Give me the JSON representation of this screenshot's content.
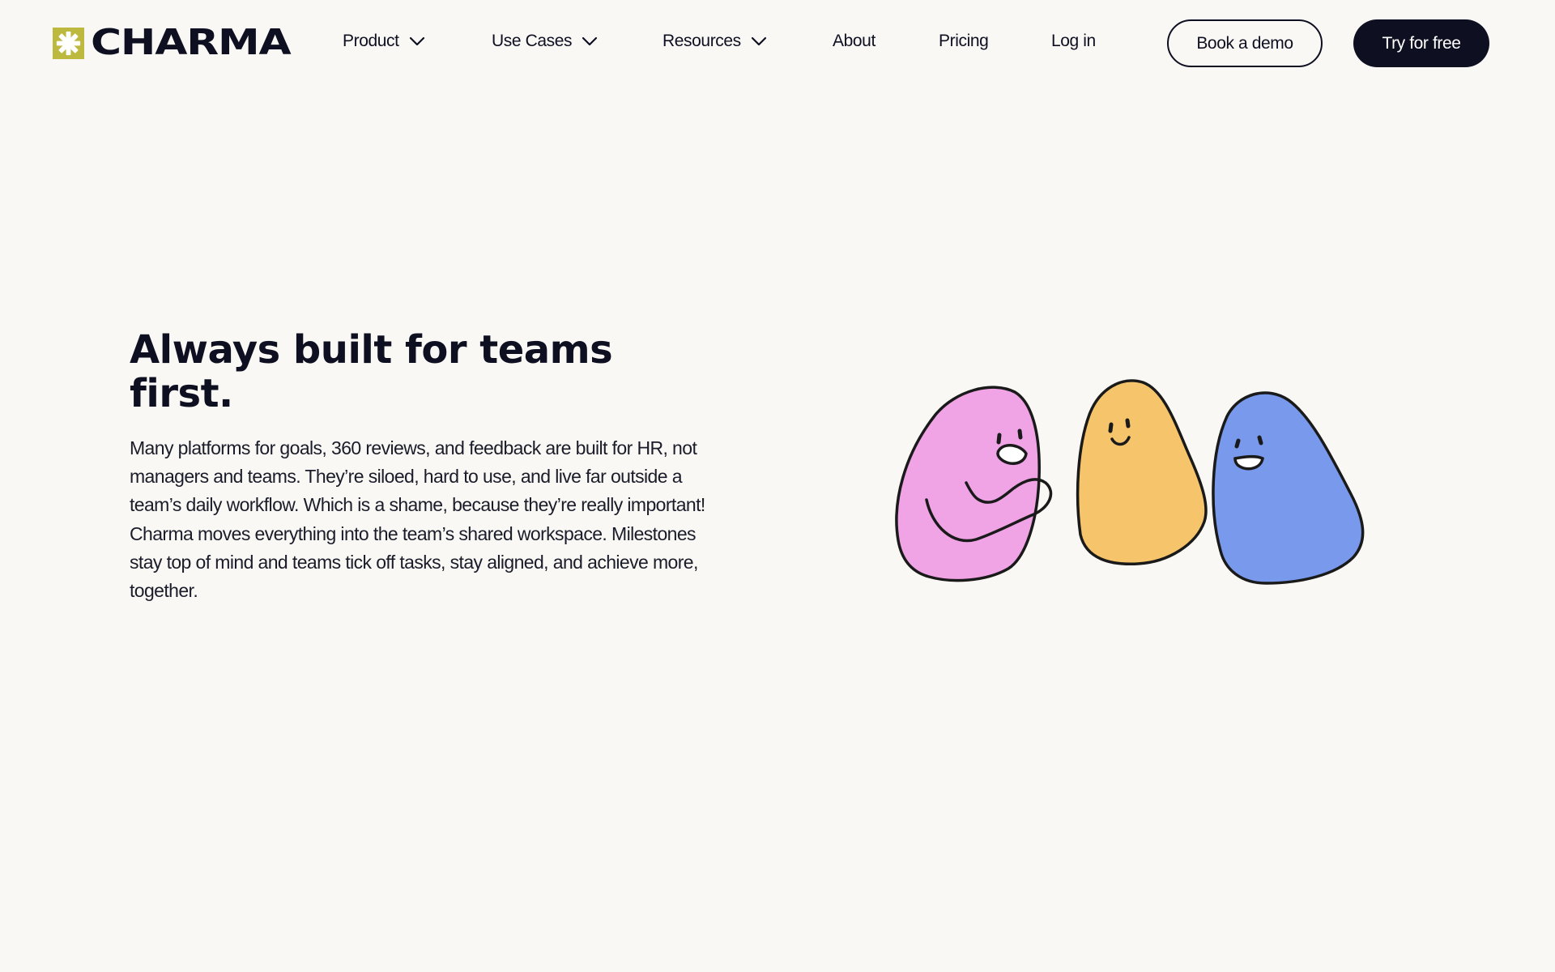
{
  "brand": {
    "name": "CHARMA",
    "mark_color": "#bdb83e"
  },
  "nav": {
    "product": "Product",
    "use_cases": "Use Cases",
    "resources": "Resources",
    "about": "About",
    "pricing": "Pricing",
    "login": "Log in"
  },
  "actions": {
    "book_demo": "Book a demo",
    "try_free": "Try for free"
  },
  "hero": {
    "title": "Always built for teams first.",
    "body": "Many platforms for goals, 360 reviews, and feedback are built for HR, not managers and teams. They’re siloed, hard to use, and live far outside a team’s daily workflow. Which is a shame, because they’re really important! Charma moves everything into the team’s shared workspace. Milestones stay top of mind and teams tick off tasks, stay aligned, and achieve more, together."
  },
  "icons": {
    "logo": "charma-star-logo-icon",
    "chevron": "chevron-down-icon"
  },
  "colors": {
    "background": "#f9f8f4",
    "text": "#0e1022",
    "button_dark": "#0e1022",
    "pink_character": "#f0a4e6",
    "yellow_character": "#f6c46a",
    "blue_character": "#7899ec"
  }
}
